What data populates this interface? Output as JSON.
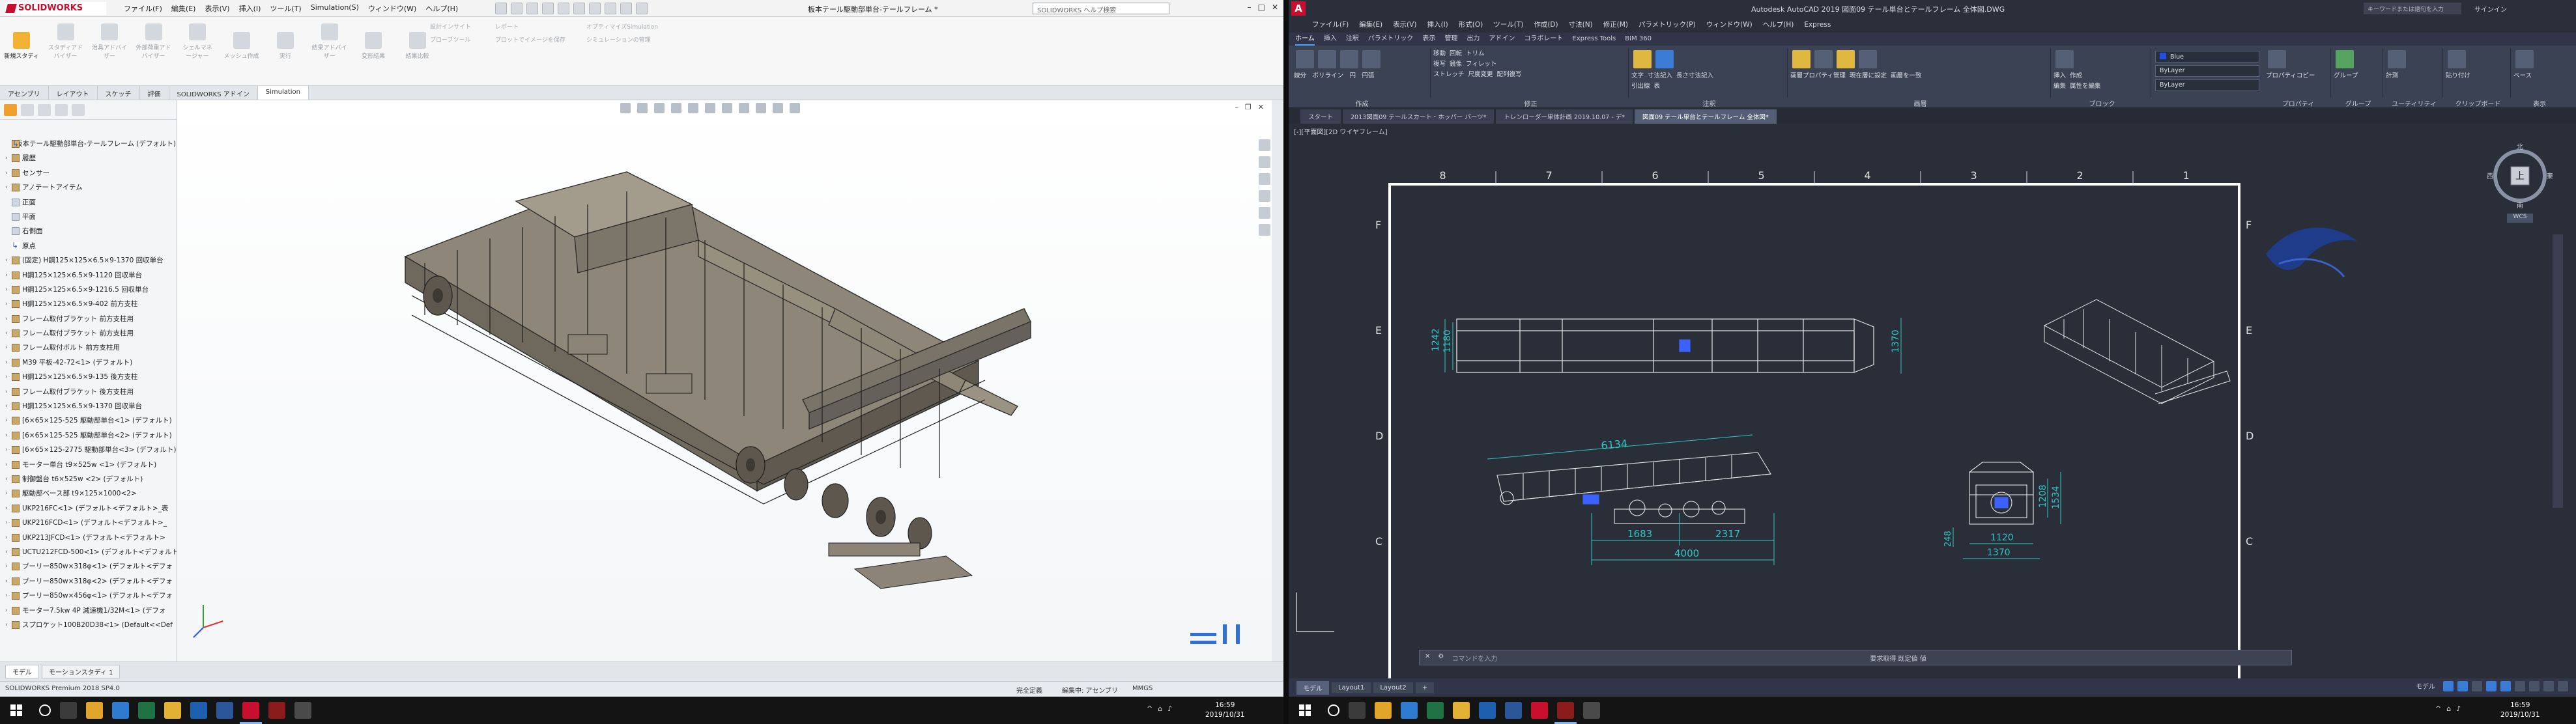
{
  "solidworks": {
    "brand": "SOLIDWORKS",
    "menu": [
      "ファイル(F)",
      "編集(E)",
      "表示(V)",
      "挿入(I)",
      "ツール(T)",
      "Simulation(S)",
      "ウィンドウ(W)",
      "ヘルプ(H)"
    ],
    "doc_title": "板本テール駆動部単台-テールフレーム *",
    "search_placeholder": "SOLIDWORKS ヘルプ検索",
    "ribbon": {
      "groups": [
        {
          "label": "新規スタディ",
          "active": true
        },
        {
          "label": "スタディアドバイザー"
        },
        {
          "label": "治具アドバイザー"
        },
        {
          "label": "外部荷重アドバイザー"
        },
        {
          "label": "シェルマネージャー"
        },
        {
          "label": "メッシュ作成"
        },
        {
          "label": "実行"
        },
        {
          "label": "結果アドバイザー"
        },
        {
          "label": "変形結果"
        },
        {
          "label": "結果比較"
        }
      ],
      "rows": [
        "設計インサイト",
        "プローブツール",
        "レポート",
        "プロットでイメージを保存",
        "オプティマイズSimulation",
        "シミュレーションの管理"
      ]
    },
    "tabs": [
      {
        "label": "アセンブリ"
      },
      {
        "label": "レイアウト"
      },
      {
        "label": "スケッチ"
      },
      {
        "label": "評価"
      },
      {
        "label": "SOLIDWORKS アドイン"
      },
      {
        "label": "Simulation",
        "active": true
      }
    ],
    "tree": {
      "root": "板本テール駆動部単台-テールフレーム (デフォルト)",
      "items": [
        {
          "label": "履歴",
          "type": "folder"
        },
        {
          "label": "センサー",
          "type": "folder"
        },
        {
          "label": "アノテートアイテム",
          "type": "folder"
        },
        {
          "label": "正面",
          "type": "plane"
        },
        {
          "label": "平面",
          "type": "plane"
        },
        {
          "label": "右側面",
          "type": "plane"
        },
        {
          "label": "原点",
          "type": "origin"
        },
        {
          "label": "(固定) H鋼125×125×6.5×9-1370  回収単台",
          "type": "part"
        },
        {
          "label": "H鋼125×125×6.5×9-1120  回収単台",
          "type": "part"
        },
        {
          "label": "H鋼125×125×6.5×9-1216.5  回収単台",
          "type": "part"
        },
        {
          "label": "H鋼125×125×6.5×9-402  前方支柱",
          "type": "part"
        },
        {
          "label": "フレーム取付ブラケット  前方支柱用",
          "type": "part"
        },
        {
          "label": "フレーム取付ブラケット  前方支柱用",
          "type": "part"
        },
        {
          "label": "フレーム取付ボルト  前方支柱用",
          "type": "part"
        },
        {
          "label": "M39  平板-42-72<1> (デフォルト)",
          "type": "part"
        },
        {
          "label": "H鋼125×125×6.5×9-135  後方支柱",
          "type": "part"
        },
        {
          "label": "フレーム取付ブラケット  後方支柱用",
          "type": "part"
        },
        {
          "label": "H鋼125×125×6.5×9-1370  回収単台",
          "type": "part"
        },
        {
          "label": "[6×65×125-525  駆動部単台<1> (デフォルト)",
          "type": "part"
        },
        {
          "label": "[6×65×125-525  駆動部単台<2> (デフォルト)",
          "type": "part"
        },
        {
          "label": "[6×65×125-2775  駆動部単台<3> (デフォルト)",
          "type": "part"
        },
        {
          "label": "モーター単台  t9×525w <1> (デフォルト)",
          "type": "part"
        },
        {
          "label": "制御盤台  t6×525w  <2> (デフォルト)",
          "type": "part"
        },
        {
          "label": "駆動部ベース部  t9×125×1000<2>",
          "type": "part"
        },
        {
          "label": "UKP216FC<1> (デフォルト<デフォルト>_表",
          "type": "part"
        },
        {
          "label": "UKP216FCD<1> (デフォルト<デフォルト>_",
          "type": "part"
        },
        {
          "label": "UKP213JFCD<1> (デフォルト<デフォルト>",
          "type": "part"
        },
        {
          "label": "UCTU212FCD-500<1> (デフォルト<デフォルト>",
          "type": "part"
        },
        {
          "label": "プーリー850w×318φ<1> (デフォルト<デフォ",
          "type": "part"
        },
        {
          "label": "プーリー850w×318φ<2> (デフォルト<デフォ",
          "type": "part"
        },
        {
          "label": "プーリー850w×456φ<1> (デフォルト<デフォ",
          "type": "part"
        },
        {
          "label": "モーター7.5kw 4P 減速機1/32M<1> (デフォ",
          "type": "part"
        },
        {
          "label": "スプロケット100B20D38<1> (Default<<Def",
          "type": "part"
        }
      ]
    },
    "bottom_tabs": [
      {
        "label": "モデル",
        "active": true
      },
      {
        "label": "モーションスタディ 1"
      }
    ],
    "status": {
      "edition": "SOLIDWORKS Premium 2018 SP4.0",
      "definition": "完全定義",
      "editing": "編集中: アセンブリ",
      "units": "MMGS"
    }
  },
  "autocad": {
    "title": "Autodesk AutoCAD 2019   図面09  テール単台とテールフレーム 全体図.DWG",
    "search_placeholder": "キーワードまたは語句を入力",
    "signin": "サインイン",
    "menu": [
      "ファイル(F)",
      "編集(E)",
      "表示(V)",
      "挿入(I)",
      "形式(O)",
      "ツール(T)",
      "作成(D)",
      "寸法(N)",
      "修正(M)",
      "パラメトリック(P)",
      "ウィンドウ(W)",
      "ヘルプ(H)",
      "Express"
    ],
    "ribbon_tabs": [
      {
        "label": "ホーム",
        "active": true
      },
      {
        "label": "挿入"
      },
      {
        "label": "注釈"
      },
      {
        "label": "パラメトリック"
      },
      {
        "label": "表示"
      },
      {
        "label": "管理"
      },
      {
        "label": "出力"
      },
      {
        "label": "アドイン"
      },
      {
        "label": "コラボレート"
      },
      {
        "label": "Express Tools"
      },
      {
        "label": "BIM 360"
      }
    ],
    "panels": [
      {
        "label": "作成",
        "buttons": [
          "線分",
          "ポリライン",
          "円",
          "円弧"
        ]
      },
      {
        "label": "修正",
        "buttons": [
          "移動",
          "回転",
          "トリム",
          "複写",
          "鏡像",
          "フィレット",
          "ストレッチ",
          "尺度変更",
          "配列複写"
        ]
      },
      {
        "label": "注釈",
        "buttons": [
          "文字",
          "寸法記入",
          "長さ寸法記入",
          "引出線",
          "表"
        ]
      },
      {
        "label": "画層",
        "buttons": [
          "画層プロパティ管理",
          "現在層に設定",
          "画層を一致"
        ]
      },
      {
        "label": "ブロック",
        "buttons": [
          "挿入",
          "作成",
          "編集",
          "属性を編集"
        ]
      },
      {
        "label": "プロパティ",
        "buttons": [
          "プロパティコピー"
        ]
      },
      {
        "label": "グループ",
        "buttons": [
          "グループ"
        ]
      },
      {
        "label": "ユーティリティ",
        "buttons": [
          "計測"
        ]
      },
      {
        "label": "クリップボード",
        "buttons": [
          "貼り付け"
        ]
      },
      {
        "label": "表示",
        "buttons": [
          "ベース"
        ]
      }
    ],
    "properties": {
      "color": "Blue",
      "linetype": "ByLayer",
      "lineweight": "ByLayer"
    },
    "file_tabs": [
      {
        "label": "スタート"
      },
      {
        "label": "2013図面09  テールスカート・ホッパー  パーツ*"
      },
      {
        "label": "トレンローダー単体計画  2019.10.07 - デ*"
      },
      {
        "label": "図面09  テール単台とテールフレーム  全体図*",
        "active": true
      }
    ],
    "viewport_label": "[-][平面図][2D ワイヤフレーム]",
    "viewcube": {
      "top": "上",
      "n": "北",
      "s": "南",
      "e": "東",
      "w": "西",
      "wcs": "WCS"
    },
    "sheet": {
      "cols": [
        "8",
        "7",
        "6",
        "5",
        "4",
        "3",
        "2",
        "1"
      ],
      "rows": [
        "F",
        "E",
        "D",
        "C"
      ]
    },
    "dims": {
      "top_w1": "1242",
      "top_w2": "1180",
      "top_w3": "1370",
      "overall": "6134",
      "d1": "1683",
      "d2": "2317",
      "d3": "4000",
      "e1": "1208",
      "e2": "1534",
      "e3": "1120",
      "e4": "1370",
      "e5": "248"
    },
    "command_prompt": "コマンドを入力",
    "command_hint": "要求取得 既定値 値",
    "layout_tabs": [
      {
        "label": "モデル",
        "active": true
      },
      {
        "label": "Layout1"
      },
      {
        "label": "Layout2"
      },
      {
        "label": "+"
      }
    ],
    "status_label": "モデル"
  },
  "taskbar": {
    "left": {
      "time": "16:59",
      "date": "2019/10/31"
    },
    "right": {
      "time": "16:59",
      "date": "2019/10/31"
    },
    "apps": [
      "edge",
      "excel",
      "explorer",
      "outlook",
      "word",
      "solidworks",
      "autocad",
      "other"
    ]
  },
  "colors": {
    "accent": "#f2b233",
    "sw_red": "#c8102e",
    "cad_bg": "#2a2e38",
    "cad_dim": "#32c6c6",
    "cad_geo": "#e8e8e8",
    "cad_blue": "#3b62ff"
  }
}
